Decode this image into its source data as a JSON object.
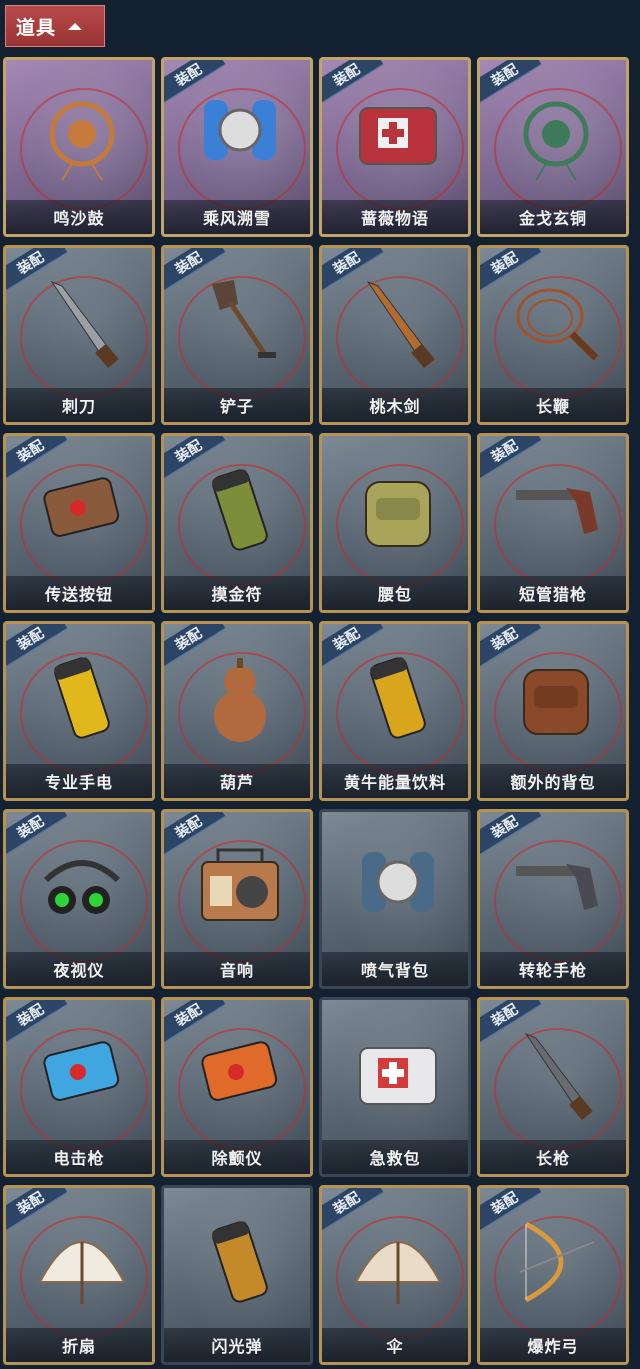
{
  "header": {
    "label": "道具",
    "icon": "chevron-up-icon"
  },
  "equip_tag": "装配",
  "items": [
    {
      "name": "鸣沙鼓",
      "equipped": false,
      "style": "purple",
      "icon": "dreamcatcher-drum-icon",
      "color": "#c47a3a"
    },
    {
      "name": "乘风溯雪",
      "equipped": true,
      "style": "purple",
      "icon": "snow-lantern-icon",
      "color": "#3c7fd6"
    },
    {
      "name": "蔷薇物语",
      "equipped": true,
      "style": "purple",
      "icon": "rose-box-icon",
      "color": "#b8333c"
    },
    {
      "name": "金戈玄铜",
      "equipped": true,
      "style": "purple",
      "icon": "bronze-grenade-icon",
      "color": "#3f7a5a"
    },
    {
      "name": "刺刀",
      "equipped": true,
      "style": "gold",
      "icon": "bayonet-icon",
      "color": "#9aa0a6"
    },
    {
      "name": "铲子",
      "equipped": true,
      "style": "gold",
      "icon": "shovel-icon",
      "color": "#5a4538"
    },
    {
      "name": "桃木剑",
      "equipped": true,
      "style": "gold",
      "icon": "wooden-sword-icon",
      "color": "#b56a2e"
    },
    {
      "name": "长鞭",
      "equipped": true,
      "style": "gold",
      "icon": "whip-icon",
      "color": "#a0522d"
    },
    {
      "name": "传送按钮",
      "equipped": true,
      "style": "gold",
      "icon": "remote-button-icon",
      "color": "#8a5a3c"
    },
    {
      "name": "摸金符",
      "equipped": true,
      "style": "gold",
      "icon": "charm-icon",
      "color": "#7d8d3a"
    },
    {
      "name": "腰包",
      "equipped": false,
      "style": "gold",
      "icon": "waist-bag-icon",
      "color": "#a8a55a"
    },
    {
      "name": "短管猎枪",
      "equipped": true,
      "style": "gold",
      "icon": "shotgun-icon",
      "color": "#7a3a2a"
    },
    {
      "name": "专业手电",
      "equipped": true,
      "style": "gold",
      "icon": "flashlight-icon",
      "color": "#e0b81c"
    },
    {
      "name": "葫芦",
      "equipped": true,
      "style": "gold",
      "icon": "gourd-icon",
      "color": "#b06a3e"
    },
    {
      "name": "黄牛能量饮料",
      "equipped": true,
      "style": "gold",
      "icon": "energy-can-icon",
      "color": "#d8a51c"
    },
    {
      "name": "额外的背包",
      "equipped": true,
      "style": "gold",
      "icon": "backpack-icon",
      "color": "#8a4a2a"
    },
    {
      "name": "夜视仪",
      "equipped": true,
      "style": "gold",
      "icon": "night-vision-icon",
      "color": "#2fd43a"
    },
    {
      "name": "音响",
      "equipped": true,
      "style": "gold",
      "icon": "radio-icon",
      "color": "#b87a4a"
    },
    {
      "name": "喷气背包",
      "equipped": false,
      "style": "plain",
      "icon": "jetpack-icon",
      "color": "#4a6a8a"
    },
    {
      "name": "转轮手枪",
      "equipped": true,
      "style": "gold",
      "icon": "revolver-icon",
      "color": "#4a4a52"
    },
    {
      "name": "电击枪",
      "equipped": true,
      "style": "gold",
      "icon": "stun-gun-icon",
      "color": "#3fa6e0"
    },
    {
      "name": "除颤仪",
      "equipped": true,
      "style": "gold",
      "icon": "defibrillator-icon",
      "color": "#e06a2a"
    },
    {
      "name": "急救包",
      "equipped": false,
      "style": "plain",
      "icon": "first-aid-kit-icon",
      "color": "#d43a3a"
    },
    {
      "name": "长枪",
      "equipped": true,
      "style": "gold",
      "icon": "spear-icon",
      "color": "#6a6a72"
    },
    {
      "name": "折扇",
      "equipped": true,
      "style": "gold",
      "icon": "folding-fan-icon",
      "color": "#f0ebe0"
    },
    {
      "name": "闪光弹",
      "equipped": false,
      "style": "plain",
      "icon": "flashbang-icon",
      "color": "#c48a2a"
    },
    {
      "name": "伞",
      "equipped": true,
      "style": "gold",
      "icon": "umbrella-icon",
      "color": "#e8dcc8"
    },
    {
      "name": "爆炸弓",
      "equipped": true,
      "style": "gold",
      "icon": "bow-icon",
      "color": "#d89a3a"
    }
  ]
}
